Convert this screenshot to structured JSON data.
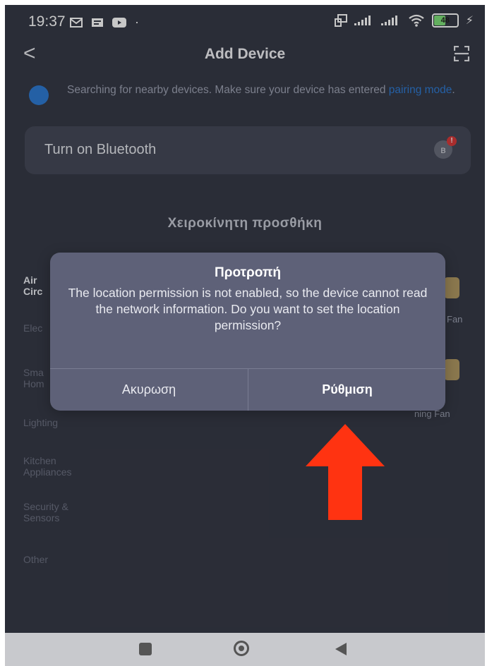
{
  "status_bar": {
    "time": "19:37",
    "battery_level": "48"
  },
  "header": {
    "title": "Add Device"
  },
  "search": {
    "text_before_link": "Searching for nearby devices. Make sure your device has entered ",
    "link_text": "pairing mode",
    "text_after_link": "."
  },
  "bluetooth_card": {
    "label": "Turn on Bluetooth",
    "badge": "!"
  },
  "manual_add": {
    "heading": "Χειροκίνητη προσθήκη"
  },
  "categories": [
    {
      "label": "Air Circ"
    },
    {
      "label": "Elec"
    },
    {
      "label": "Sma Hom"
    },
    {
      "label": "Lighting"
    },
    {
      "label": "Kitchen Appliances"
    },
    {
      "label": "Security & Sensors"
    },
    {
      "label": "Other"
    }
  ],
  "devices": [
    {
      "label": "Fan"
    },
    {
      "label": "ning Fan"
    }
  ],
  "dialog": {
    "title": "Προτροπή",
    "message": "The location permission is not enabled, so the device cannot read the network information. Do you want to set the location permission?",
    "cancel_label": "Ακυρωση",
    "confirm_label": "Ρύθμιση"
  },
  "colors": {
    "background": "#373a47",
    "dialog": "#5e6178",
    "accent_link": "#2f7bd4",
    "annotation_arrow": "#ff3311"
  }
}
